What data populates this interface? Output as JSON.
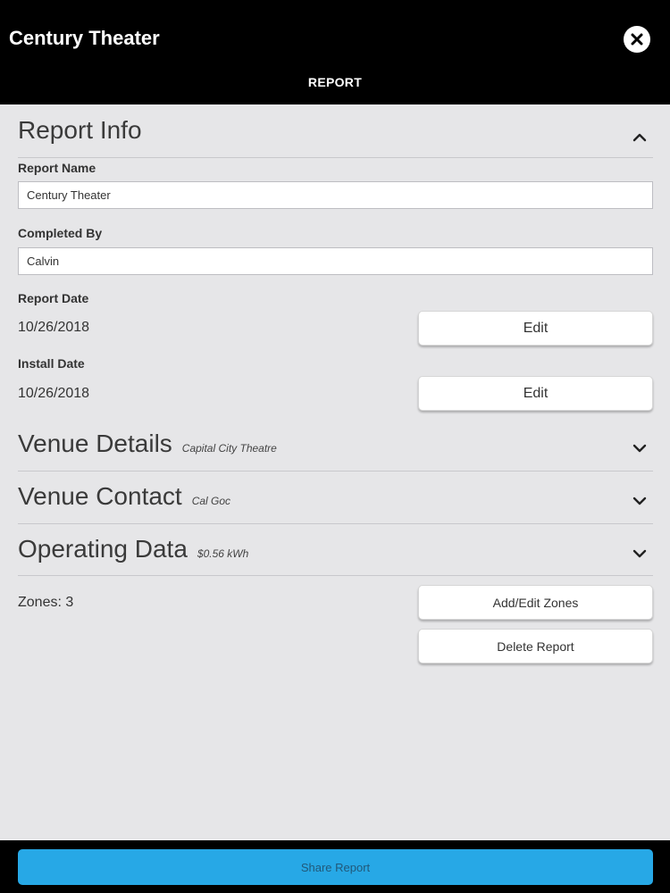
{
  "header": {
    "title": "Century Theater",
    "tab": "REPORT",
    "close_icon": "close-icon"
  },
  "report_info": {
    "title": "Report Info",
    "expanded": true,
    "report_name_label": "Report Name",
    "report_name_value": "Century Theater",
    "completed_by_label": "Completed By",
    "completed_by_value": "Calvin",
    "report_date_label": "Report Date",
    "report_date_value": "10/26/2018",
    "report_date_edit": "Edit",
    "install_date_label": "Install Date",
    "install_date_value": "10/26/2018",
    "install_date_edit": "Edit"
  },
  "venue_details": {
    "title": "Venue Details",
    "subtitle": "Capital City Theatre"
  },
  "venue_contact": {
    "title": "Venue Contact",
    "subtitle": "Cal Goc"
  },
  "operating_data": {
    "title": "Operating Data",
    "subtitle": "$0.56 kWh"
  },
  "zones": {
    "label": "Zones: 3",
    "add_edit_button": "Add/Edit Zones",
    "delete_button": "Delete Report"
  },
  "footer": {
    "share_button": "Share Report"
  },
  "colors": {
    "header_bg": "#000000",
    "page_bg": "#e6e6e8",
    "share_button": "#27a8e6"
  }
}
